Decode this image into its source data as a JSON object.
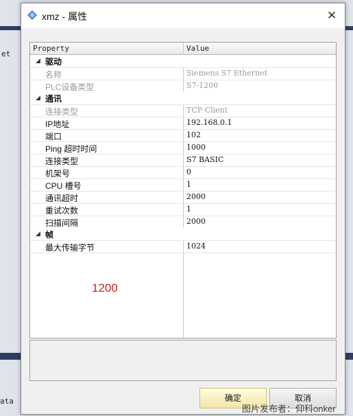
{
  "background": {
    "left_text": "et",
    "bottom_text": "ata"
  },
  "dialog": {
    "title": "xmz - 属性",
    "close_icon": "close-icon",
    "app_icon": "diamond-icon"
  },
  "grid": {
    "header": {
      "property": "Property",
      "value": "Value"
    },
    "categories": [
      {
        "name": "驱动",
        "rows": [
          {
            "name": "名称",
            "value": "Siemens S7 Ethernet",
            "readonly": true
          },
          {
            "name": "PLC设备类型",
            "value": "S7-1200",
            "readonly": true
          }
        ]
      },
      {
        "name": "通讯",
        "rows": [
          {
            "name": "连接类型",
            "value": "TCP Client",
            "readonly": true
          },
          {
            "name": "IP地址",
            "value": "192.168.0.1",
            "readonly": false
          },
          {
            "name": "端口",
            "value": "102",
            "readonly": false
          },
          {
            "name": "Ping 超时时间",
            "value": "1000",
            "readonly": false
          },
          {
            "name": "连接类型",
            "value": "S7 BASIC",
            "readonly": false
          },
          {
            "name": "机架号",
            "value": "0",
            "readonly": false
          },
          {
            "name": "CPU 槽号",
            "value": "1",
            "readonly": false
          },
          {
            "name": "通讯超时",
            "value": "2000",
            "readonly": false
          },
          {
            "name": "重试次数",
            "value": "1",
            "readonly": false
          },
          {
            "name": "扫描间隔",
            "value": "2000",
            "readonly": false
          }
        ]
      },
      {
        "name": "帧",
        "rows": [
          {
            "name": "最大传输字节",
            "value": "1024",
            "readonly": false
          }
        ]
      }
    ],
    "annotation": "1200"
  },
  "buttons": {
    "ok": "确定",
    "cancel": "取消"
  },
  "watermark": "图片发布者：仰科onker",
  "colors": {
    "annotation": "#d62020",
    "readonly_text": "#9a9a9a",
    "ok_button": "#f2e5a8"
  }
}
